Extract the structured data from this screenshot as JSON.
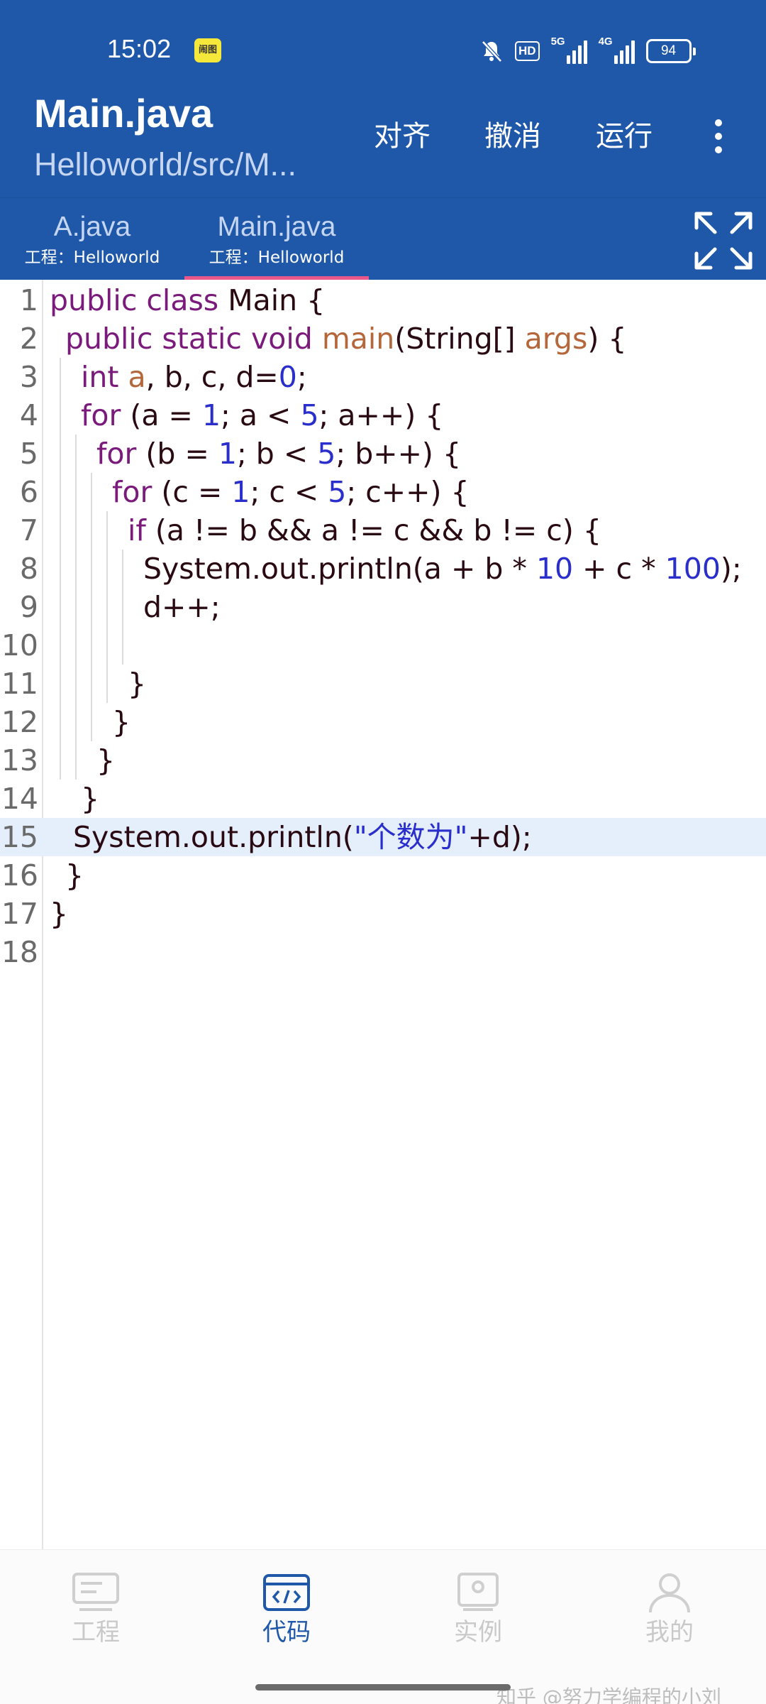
{
  "status_bar": {
    "time": "15:02",
    "badge": "闹图",
    "hd": "HD",
    "network_1": "5G",
    "network_2": "4G",
    "battery": "94"
  },
  "header": {
    "title": "Main.java",
    "path": "Helloworld/src/M...",
    "actions": [
      "对齐",
      "撤消",
      "运行"
    ]
  },
  "tabs": [
    {
      "name": "A.java",
      "project": "工程：Helloworld",
      "active": false
    },
    {
      "name": "Main.java",
      "project": "工程：Helloworld",
      "active": true
    }
  ],
  "editor": {
    "active_line": 15,
    "colors": {
      "keyword": "#7a1b7c",
      "identifier": "#b4673b",
      "number": "#2a2fcc",
      "string": "#2a2fcc",
      "text": "#2a0a12",
      "active_line_bg": "#e4effb"
    },
    "lines": [
      {
        "n": "1",
        "indent": 0,
        "tokens": [
          [
            "kw",
            "public class"
          ],
          [
            "pl",
            " Main {"
          ]
        ]
      },
      {
        "n": "2",
        "indent": 1,
        "tokens": [
          [
            "kw",
            "public static void"
          ],
          [
            "pl",
            " "
          ],
          [
            "fn",
            "main"
          ],
          [
            "pl",
            "(String[] "
          ],
          [
            "fn",
            "args"
          ],
          [
            "pl",
            ") {"
          ]
        ]
      },
      {
        "n": "3",
        "indent": 2,
        "tokens": [
          [
            "kw",
            "int"
          ],
          [
            "pl",
            " "
          ],
          [
            "fn",
            "a"
          ],
          [
            "pl",
            ", b, c, d="
          ],
          [
            "num",
            "0"
          ],
          [
            "pl",
            ";"
          ]
        ]
      },
      {
        "n": "4",
        "indent": 2,
        "tokens": [
          [
            "kw",
            "for"
          ],
          [
            "pl",
            " (a = "
          ],
          [
            "num",
            "1"
          ],
          [
            "pl",
            "; a < "
          ],
          [
            "num",
            "5"
          ],
          [
            "pl",
            "; a++) {"
          ]
        ]
      },
      {
        "n": "5",
        "indent": 3,
        "tokens": [
          [
            "kw",
            "for"
          ],
          [
            "pl",
            " (b = "
          ],
          [
            "num",
            "1"
          ],
          [
            "pl",
            "; b < "
          ],
          [
            "num",
            "5"
          ],
          [
            "pl",
            "; b++) {"
          ]
        ]
      },
      {
        "n": "6",
        "indent": 4,
        "tokens": [
          [
            "kw",
            "for"
          ],
          [
            "pl",
            " (c = "
          ],
          [
            "num",
            "1"
          ],
          [
            "pl",
            "; c < "
          ],
          [
            "num",
            "5"
          ],
          [
            "pl",
            "; c++) {"
          ]
        ]
      },
      {
        "n": "7",
        "indent": 5,
        "tokens": [
          [
            "kw",
            "if"
          ],
          [
            "pl",
            " (a != b && a != c && b != c) {"
          ]
        ]
      },
      {
        "n": "8",
        "indent": 6,
        "tokens": [
          [
            "pl",
            "System.out.println(a + b * "
          ],
          [
            "num",
            "10"
          ],
          [
            "pl",
            " + c * "
          ],
          [
            "num",
            "100"
          ],
          [
            "pl",
            ");"
          ]
        ]
      },
      {
        "n": "9",
        "indent": 6,
        "tokens": [
          [
            "pl",
            "d++;"
          ]
        ]
      },
      {
        "n": "10",
        "indent": 6,
        "tokens": []
      },
      {
        "n": "11",
        "indent": 5,
        "tokens": [
          [
            "pl",
            "}"
          ]
        ]
      },
      {
        "n": "12",
        "indent": 4,
        "tokens": [
          [
            "pl",
            "}"
          ]
        ]
      },
      {
        "n": "13",
        "indent": 3,
        "tokens": [
          [
            "pl",
            "}"
          ]
        ]
      },
      {
        "n": "14",
        "indent": 2,
        "tokens": [
          [
            "pl",
            "}"
          ]
        ]
      },
      {
        "n": "15",
        "indent": 1.5,
        "tokens": [
          [
            "pl",
            "System.out.println("
          ],
          [
            "str",
            "\"个数为\""
          ],
          [
            "pl",
            "+d);"
          ]
        ]
      },
      {
        "n": "16",
        "indent": 1,
        "tokens": [
          [
            "pl",
            "}"
          ]
        ]
      },
      {
        "n": "17",
        "indent": 0,
        "tokens": [
          [
            "pl",
            "}"
          ]
        ]
      },
      {
        "n": "18",
        "indent": 0,
        "tokens": []
      }
    ]
  },
  "bottom_nav": [
    {
      "label": "工程",
      "icon": "project-icon",
      "active": false
    },
    {
      "label": "代码",
      "icon": "code-icon",
      "active": true
    },
    {
      "label": "实例",
      "icon": "examples-icon",
      "active": false
    },
    {
      "label": "我的",
      "icon": "profile-icon",
      "active": false
    }
  ],
  "watermark": "知乎 @努力学编程的小刘"
}
